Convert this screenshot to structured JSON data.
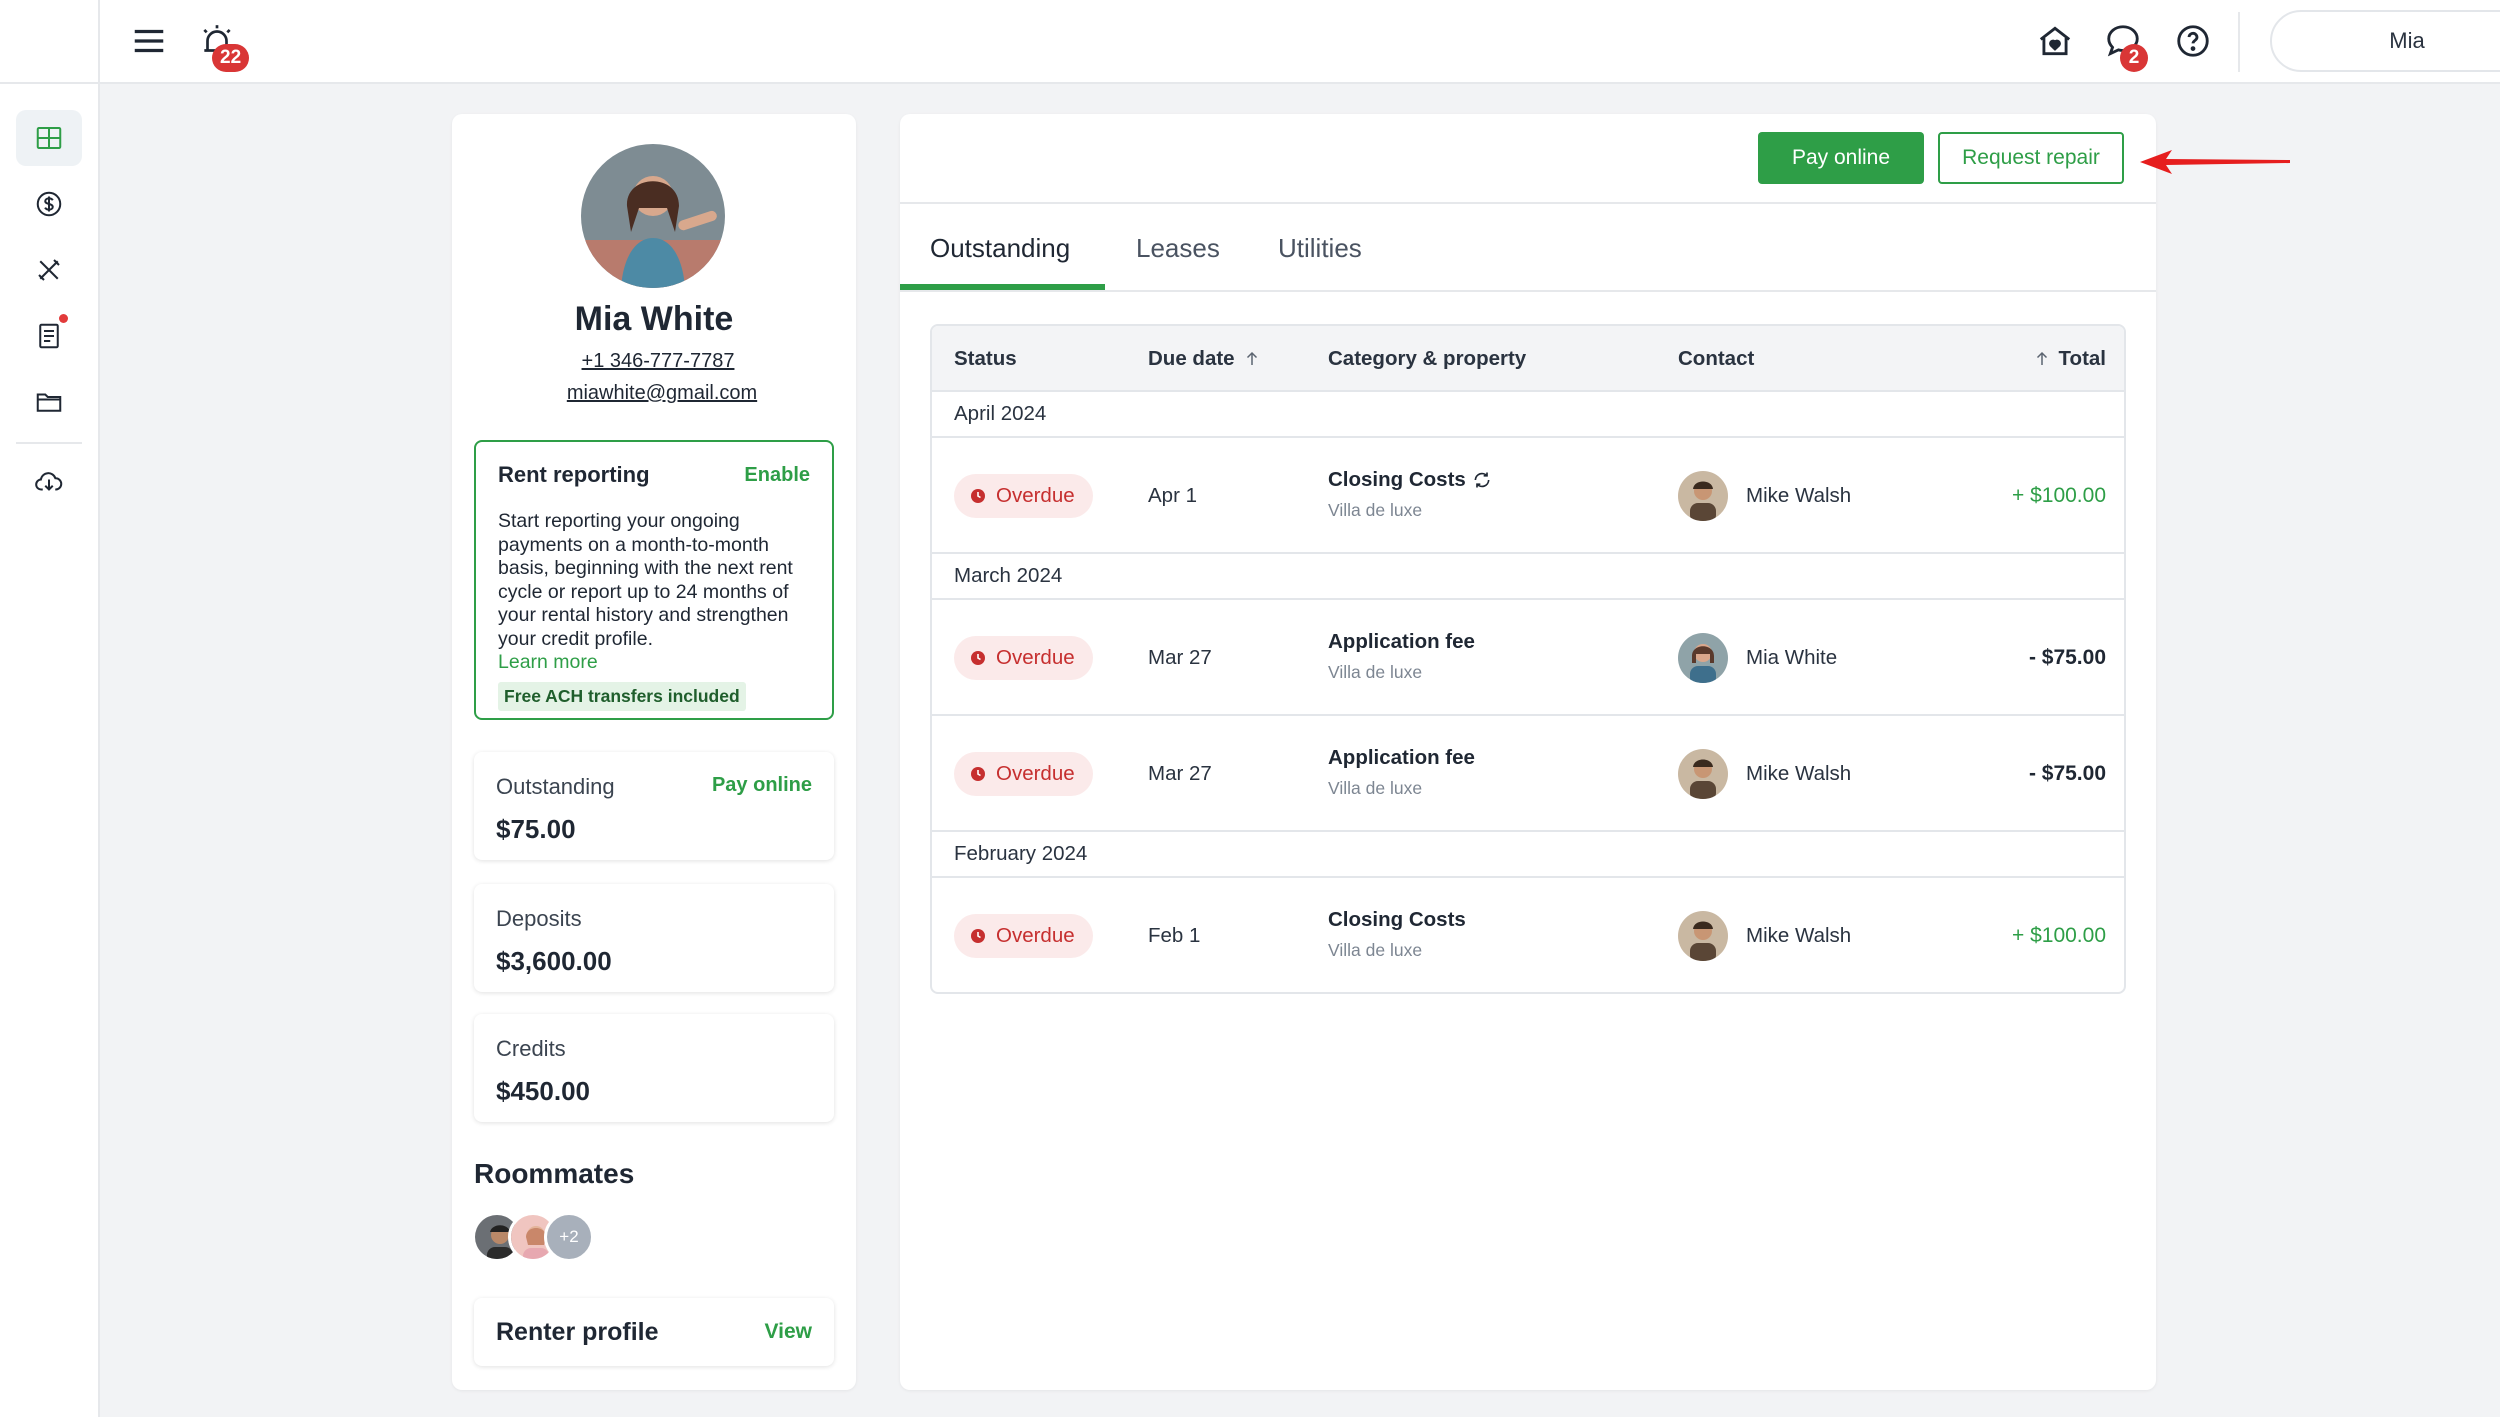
{
  "topbar": {
    "notifications_count": "22",
    "messages_count": "2",
    "user_name": "Mia"
  },
  "profile": {
    "name": "Mia White",
    "phone": "+1 346-777-7787",
    "email": "miawhite@gmail.com",
    "rent_reporting": {
      "title": "Rent reporting",
      "enable_label": "Enable",
      "body": "Start reporting your ongoing payments on a month-to-month basis, beginning with the next rent cycle or report up to 24 months of your rental history and strengthen your credit profile.",
      "learn_more": "Learn more",
      "ach_badge": "Free ACH transfers included"
    },
    "outstanding": {
      "label": "Outstanding",
      "value": "$75.00",
      "action": "Pay online"
    },
    "deposits": {
      "label": "Deposits",
      "value": "$3,600.00"
    },
    "credits": {
      "label": "Credits",
      "value": "$450.00"
    },
    "roommates": {
      "title": "Roommates",
      "more": "+2"
    },
    "renter_profile": {
      "label": "Renter profile",
      "action": "View"
    }
  },
  "main": {
    "pay_online": "Pay online",
    "request_repair": "Request repair",
    "tabs": [
      {
        "label": "Outstanding"
      },
      {
        "label": "Leases"
      },
      {
        "label": "Utilities"
      }
    ],
    "table": {
      "headers": {
        "status": "Status",
        "due_date": "Due date",
        "category": "Category & property",
        "contact": "Contact",
        "total": "Total"
      },
      "groups": [
        {
          "label": "April 2024"
        },
        {
          "label": "March 2024"
        },
        {
          "label": "February 2024"
        }
      ],
      "rows": [
        {
          "status": "Overdue",
          "date": "Apr 1",
          "category": "Closing Costs",
          "property": "Villa de luxe",
          "contact": "Mike Walsh",
          "total": "+ $100.00"
        },
        {
          "status": "Overdue",
          "date": "Mar 27",
          "category": "Application fee",
          "property": "Villa de luxe",
          "contact": "Mia White",
          "total": "- $75.00"
        },
        {
          "status": "Overdue",
          "date": "Mar 27",
          "category": "Application fee",
          "property": "Villa de luxe",
          "contact": "Mike Walsh",
          "total": "- $75.00"
        },
        {
          "status": "Overdue",
          "date": "Feb 1",
          "category": "Closing Costs",
          "property": "Villa de luxe",
          "contact": "Mike Walsh",
          "total": "+ $100.00"
        }
      ]
    }
  },
  "colors": {
    "accent": "#2e9e47",
    "overdue": "#c62f2f",
    "badge": "#d93636",
    "annotation_arrow": "#e61e1e"
  },
  "icons": {
    "rail": [
      "dashboard-icon",
      "dollar-icon",
      "tools-icon",
      "document-icon",
      "folder-icon",
      "cloud-download-icon"
    ],
    "topbar": [
      "menu-icon",
      "alarm-icon",
      "home-heart-icon",
      "chat-icon",
      "help-icon"
    ]
  }
}
